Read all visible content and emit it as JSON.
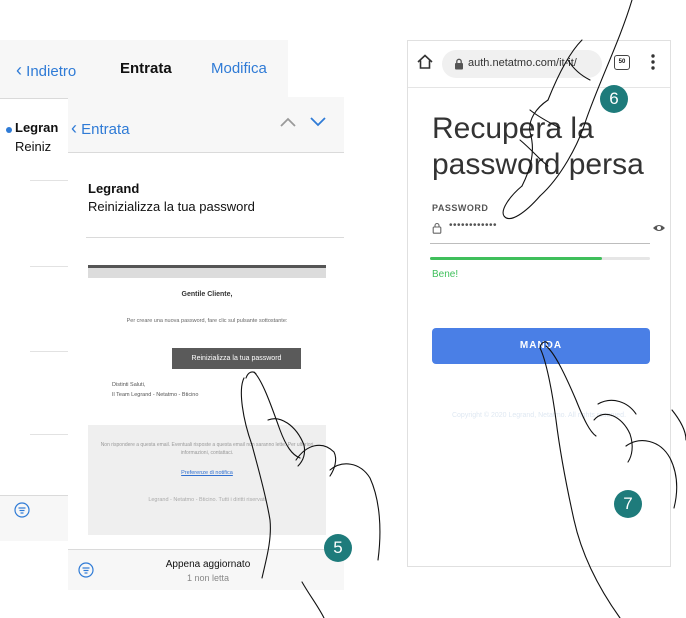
{
  "mail_list": {
    "back_label": "Indietro",
    "title": "Entrata",
    "edit_label": "Modifica",
    "sender": "Legran",
    "preview": "Reiniz"
  },
  "mail_detail": {
    "back_label": "Entrata",
    "sender": "Legrand",
    "subject": "Reinizializza la tua password",
    "email": {
      "greeting": "Gentile Cliente,",
      "instruction": "Per creare una nuova password, fare clic sul pulsante sottostante:",
      "button_label": "Reinizializza la tua password",
      "sign_off": "Distinti Saluti,",
      "signature": "Il Team Legrand - Netatmo - Bticino",
      "footer_text": "Non rispondere a questa email. Eventuali risposte a questa email non saranno lette. Per ulteriori informazioni, contattaci.",
      "footer_link": "Preferenze di notifica",
      "footer_copy": "Legrand - Netatmo - Bticino. Tutti i diritti riservati"
    },
    "status": "Appena aggiornato",
    "unread": "1 non letta"
  },
  "browser": {
    "url": "auth.netatmo.com/it-it/",
    "tab_count": "50",
    "heading": "Recupera la password persa",
    "password_label": "PASSWORD",
    "password_value": "••••••••••••",
    "strength_fraction": 0.78,
    "strength_label": "Bene!",
    "submit_label": "MANDA",
    "copyright": "Copyright © 2020 Legrand, Netatmo. All rights reserved."
  },
  "steps": [
    "5",
    "6",
    "7"
  ],
  "colors": {
    "ios_blue": "#2f7bd6",
    "step_badge": "#1e7b7b",
    "send_button": "#4a7fe6",
    "strength": "#3fbf5b"
  },
  "icons": [
    "home-icon",
    "lock-icon",
    "tabs-icon",
    "menu-icon",
    "eye-icon",
    "filter-icon",
    "chevron-up-icon",
    "chevron-down-icon",
    "hand-icon"
  ]
}
